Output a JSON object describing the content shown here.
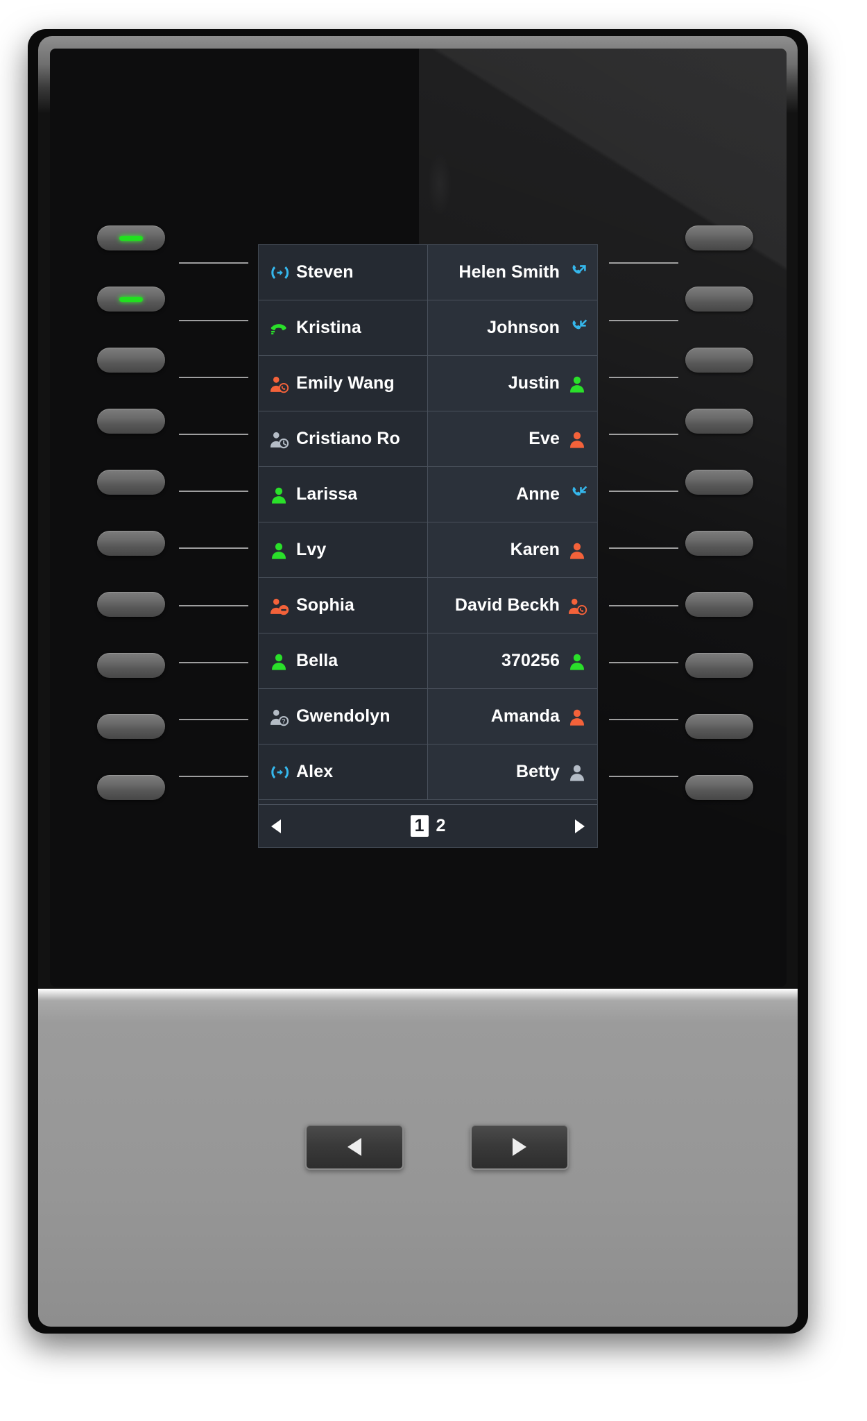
{
  "device": {
    "name": "ip-phone-expansion-module",
    "screen_label": "BLF contact list"
  },
  "list": {
    "rows": [
      {
        "left": {
          "label": "Steven",
          "icon": "call-transfer-icon",
          "color": "#35b7ec"
        },
        "right": {
          "label": "Helen Smith",
          "icon": "call-outgoing-icon",
          "color": "#35b7ec"
        }
      },
      {
        "left": {
          "label": "Kristina",
          "icon": "handset-ringing-icon",
          "color": "#2ae02a"
        },
        "right": {
          "label": "Johnson",
          "icon": "call-incoming-icon",
          "color": "#35b7ec"
        }
      },
      {
        "left": {
          "label": "Emily Wang",
          "icon": "user-on-call-icon",
          "color": "#f4623a"
        },
        "right": {
          "label": "Justin",
          "icon": "user-icon",
          "color": "#2ae02a"
        }
      },
      {
        "left": {
          "label": "Cristiano Ro",
          "icon": "user-clock-icon",
          "color": "#b4bcc6"
        },
        "right": {
          "label": "Eve",
          "icon": "user-icon",
          "color": "#f4623a"
        }
      },
      {
        "left": {
          "label": "Larissa",
          "icon": "user-icon",
          "color": "#2ae02a"
        },
        "right": {
          "label": "Anne",
          "icon": "call-incoming-icon",
          "color": "#35b7ec"
        }
      },
      {
        "left": {
          "label": "Lvy",
          "icon": "user-icon",
          "color": "#2ae02a"
        },
        "right": {
          "label": "Karen",
          "icon": "user-icon",
          "color": "#f4623a"
        }
      },
      {
        "left": {
          "label": "Sophia",
          "icon": "user-dnd-icon",
          "color": "#f4623a"
        },
        "right": {
          "label": "David Beckh",
          "icon": "user-on-call-icon",
          "color": "#f4623a"
        }
      },
      {
        "left": {
          "label": "Bella",
          "icon": "user-icon",
          "color": "#2ae02a"
        },
        "right": {
          "label": "370256",
          "icon": "user-icon",
          "color": "#2ae02a"
        }
      },
      {
        "left": {
          "label": "Gwendolyn",
          "icon": "user-unknown-icon",
          "color": "#b4bcc6"
        },
        "right": {
          "label": "Amanda",
          "icon": "user-icon",
          "color": "#f4623a"
        }
      },
      {
        "left": {
          "label": "Alex",
          "icon": "call-transfer-icon",
          "color": "#35b7ec"
        },
        "right": {
          "label": "Betty",
          "icon": "user-icon",
          "color": "#b4bcc6"
        }
      }
    ]
  },
  "pager": {
    "prev_icon": "triangle-left-icon",
    "next_icon": "triangle-right-icon",
    "pages": [
      "1",
      "2"
    ],
    "current_page": "1"
  },
  "hardware": {
    "left_keys": [
      {
        "label": "",
        "led": "on"
      },
      {
        "label": "",
        "led": "on"
      },
      {
        "label": "",
        "led": "off"
      },
      {
        "label": "",
        "led": "off"
      },
      {
        "label": "",
        "led": "off"
      },
      {
        "label": "",
        "led": "off"
      },
      {
        "label": "",
        "led": "off"
      },
      {
        "label": "",
        "led": "off"
      },
      {
        "label": "",
        "led": "off"
      },
      {
        "label": "",
        "led": "off"
      }
    ],
    "right_keys": [
      {
        "label": "",
        "led": "off"
      },
      {
        "label": "",
        "led": "off"
      },
      {
        "label": "",
        "led": "off"
      },
      {
        "label": "",
        "led": "off"
      },
      {
        "label": "",
        "led": "off"
      },
      {
        "label": "",
        "led": "off"
      },
      {
        "label": "",
        "led": "off"
      },
      {
        "label": "",
        "led": "off"
      },
      {
        "label": "",
        "led": "off"
      },
      {
        "label": "",
        "led": "off"
      }
    ],
    "page_prev": {
      "label": "",
      "icon": "triangle-left-icon"
    },
    "page_next": {
      "label": "",
      "icon": "triangle-right-icon"
    }
  },
  "colors": {
    "status_available": "#2ae02a",
    "status_busy": "#f4623a",
    "status_unknown": "#b4bcc6",
    "status_call": "#35b7ec",
    "lcd_background": "#262b33",
    "lcd_gridline": "#4a515c"
  }
}
